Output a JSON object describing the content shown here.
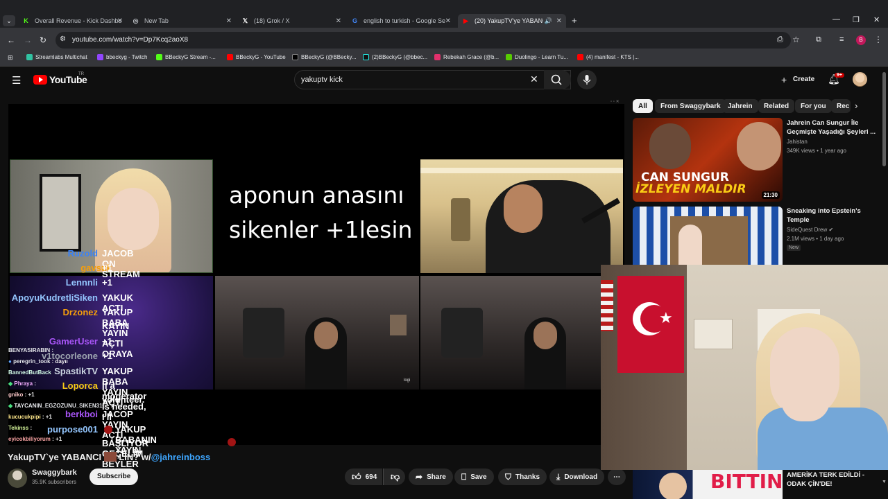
{
  "browser": {
    "tabs": [
      {
        "label": "Overall Revenue - Kick Dashbo",
        "icon": "kick-icon"
      },
      {
        "label": "New Tab",
        "icon": "globe-icon"
      },
      {
        "label": "(18) Grok / X",
        "icon": "x-icon"
      },
      {
        "label": "english to turkish - Google Sea",
        "icon": "google-icon"
      },
      {
        "label": "(20) YakupTV'ye YABANCI",
        "icon": "youtube-icon",
        "active": true
      }
    ],
    "url": "youtube.com/watch?v=Dp7Kcq2aoX8",
    "bookmarks": [
      "Streamlabs Multichat",
      "bbeckyg - Twitch",
      "BBeckyG Stream -...",
      "BBeckyG - YouTube",
      "BBeckyG (@BBecky...",
      "(2)BBeckyG (@bbec...",
      "Rebekah Grace (@b...",
      "Duolingo - Learn Tu...",
      "(4) manifest - KTS |..."
    ]
  },
  "youtube": {
    "logo": "YouTube",
    "region": "TR",
    "search_value": "yakuptv kick",
    "create_label": "Create",
    "notification_count": "9+",
    "avatar_letter": "B"
  },
  "video": {
    "overlay_text_line1": "aponun anasını",
    "overlay_text_line2": "sikenler +1lesin",
    "cam_label": "logi",
    "chat": [
      {
        "name": "Ruzold",
        "msg": "JACOB ON STREAM",
        "color": "#3b82f6"
      },
      {
        "name": "gavsuk",
        "msg": "+1",
        "color": "#f59e0b"
      },
      {
        "name": "Lennnli",
        "msg": "+1",
        "color": "#60a5fa"
      },
      {
        "name": "ApoyuKudretliSiken",
        "msg": "YAKUK AÇTI",
        "color": "#60a5fa"
      },
      {
        "name": "Drzonez",
        "msg": "YAKUP BABA YAYIN AÇTI ORAYA",
        "msg2": "KAYIN",
        "color": "#f59e0b"
      },
      {
        "name": "GamerUser",
        "msg": "+1",
        "color": "#a855f7"
      },
      {
        "name": "v1tocorleone",
        "msg": "+1",
        "color": "#9ca3af"
      },
      {
        "name": "SpastikTV",
        "msg": "YAKUP BABA YAYIN AÇTI",
        "color": "#9ca3af"
      },
      {
        "name": "Loporca",
        "msg": "If a moderator is needed, I'll",
        "msg2": "volunteer.",
        "color": "#facc15"
      },
      {
        "name": "berkboi",
        "msg": "JACOP YAYIN AÇTI",
        "color": "#a855f7"
      },
      {
        "name": "purpose001",
        "msg": "YAKUP BABANIN YAYIN",
        "msg2": "BAŞLIYOR GEÇELİM BEYLER",
        "color": "#60a5fa"
      }
    ],
    "small_chat": [
      {
        "name": "BENYASIRABIN",
        "msg": ":"
      },
      {
        "name": "peregrin_took",
        "msg": ": dayıı"
      },
      {
        "name": "BannedButBack",
        "msg": ""
      },
      {
        "name": "Phraya",
        "msg": ":"
      },
      {
        "name": "gniko",
        "msg": ": +1"
      },
      {
        "name": "TAYCANIN_EGZOZUNU_SIKEN31",
        "msg": ":"
      },
      {
        "name": "kucucukpipi",
        "msg": ": +1"
      },
      {
        "name": "Tekinss",
        "msg": ":"
      },
      {
        "name": "eyicokbiliyorum",
        "msg": ": +1"
      }
    ],
    "title": "YakupTV`ye YABANCI ... LİN? w/@jahreinboss",
    "title_prefix": "YakupTV`ye YABANCI",
    "title_suffix": "LİN? w/",
    "title_mention": "@jahreinboss",
    "channel": "Swaggybark",
    "subscribers": "35.9K subscribers",
    "subscribe_label": "Subscribe",
    "likes": "694",
    "actions": [
      "Share",
      "Save",
      "Thanks",
      "Download"
    ]
  },
  "sidebar": {
    "chips": [
      "All",
      "From Swaggybark",
      "Jahrein",
      "Related",
      "For you",
      "Rec"
    ],
    "videos": [
      {
        "title_line1": "Jahrein Can Sungur İle",
        "title_line2": "Geçmişte Yaşadığı Şeyleri ...",
        "channel": "Jahistan",
        "meta": "349K views • 1 year ago",
        "duration": "21:30",
        "thumb_text1": "CAN SUNGUR",
        "thumb_text2": "İZLEYEN MALDIR"
      },
      {
        "title_line1": "Sneaking into Epstein's",
        "title_line2": "Temple",
        "channel": "SideQuest Drew",
        "meta": "2.1M views • 1 day ago",
        "badge": "New"
      },
      {
        "title_line1": "AMERİKA TERK EDİLDİ -",
        "title_line2": "ODAK ÇİN'DE!",
        "thumb_text1": "BITTIN"
      }
    ]
  }
}
